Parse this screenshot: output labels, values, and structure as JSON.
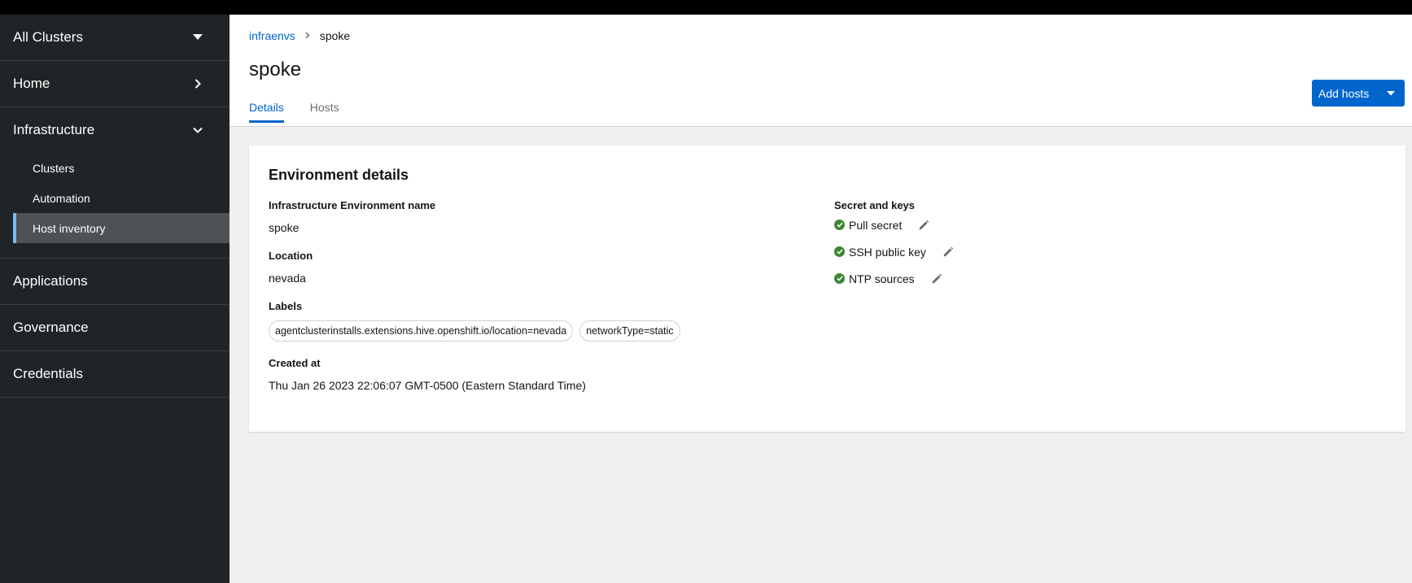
{
  "sidebar": {
    "cluster_switcher": "All Clusters",
    "home": "Home",
    "infrastructure": {
      "label": "Infrastructure",
      "items": [
        {
          "label": "Clusters"
        },
        {
          "label": "Automation"
        },
        {
          "label": "Host inventory",
          "active": true
        }
      ]
    },
    "applications": "Applications",
    "governance": "Governance",
    "credentials": "Credentials"
  },
  "header": {
    "breadcrumb": [
      "infraenvs",
      "spoke"
    ],
    "title": "spoke",
    "tabs": [
      "Details",
      "Hosts"
    ],
    "active_tab": "Details",
    "add_hosts_label": "Add hosts"
  },
  "details": {
    "title": "Environment details",
    "name_label": "Infrastructure Environment name",
    "name_value": "spoke",
    "location_label": "Location",
    "location_value": "nevada",
    "labels_label": "Labels",
    "labels": [
      "agentclusterinstalls.extensions.hive.openshift.io/location=nevada",
      "networkType=static"
    ],
    "created_label": "Created at",
    "created_value": "Thu Jan 26 2023 22:06:07 GMT-0500 (Eastern Standard Time)",
    "secrets_label": "Secret and keys",
    "secrets": [
      "Pull secret",
      "SSH public key",
      "NTP sources"
    ]
  },
  "colors": {
    "accent": "#0066cc",
    "sidebar_bg": "#212427",
    "success": "#3e8635"
  },
  "icons": {
    "check": "check-circle-icon",
    "edit": "pencil-icon",
    "caret": "caret-down-icon",
    "chevron_right": "chevron-right-icon",
    "chevron_down": "chevron-down-icon"
  }
}
